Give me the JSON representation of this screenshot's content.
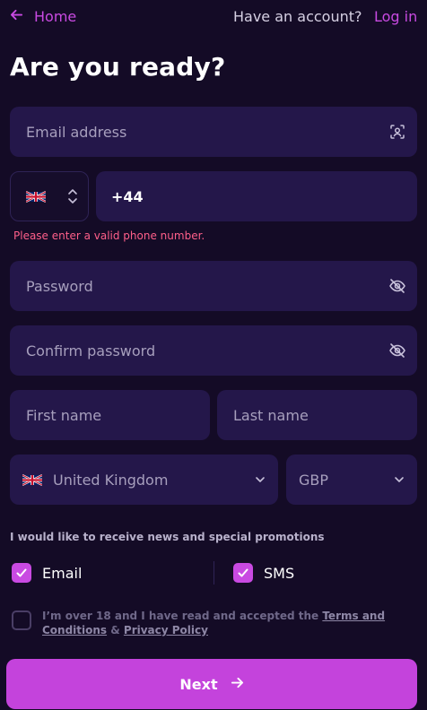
{
  "header": {
    "back_label": "Home",
    "have_account_text": "Have an account?",
    "login_label": "Log in"
  },
  "title": "Are you ready?",
  "form": {
    "email_placeholder": "Email address",
    "phone_country_flag": "gb-flag-icon",
    "phone_value": "+44",
    "phone_error": "Please enter a valid phone number.",
    "password_placeholder": "Password",
    "confirm_password_placeholder": "Confirm password",
    "first_name_placeholder": "First name",
    "last_name_placeholder": "Last name",
    "country_value": "United Kingdom",
    "currency_value": "GBP"
  },
  "promotions": {
    "text": "I would like to receive news and special promotions",
    "email_label": "Email",
    "email_checked": true,
    "sms_label": "SMS",
    "sms_checked": true
  },
  "terms": {
    "prefix": "I’m over 18 and I have read and accepted the ",
    "terms_link": "Terms and Conditions",
    "joiner": " & ",
    "privacy_link": "Privacy Policy",
    "checked": false
  },
  "next_label": "Next",
  "colors": {
    "background": "#140b26",
    "field": "#24174a",
    "accent": "#c94ae2",
    "error": "#ff5f8a"
  }
}
